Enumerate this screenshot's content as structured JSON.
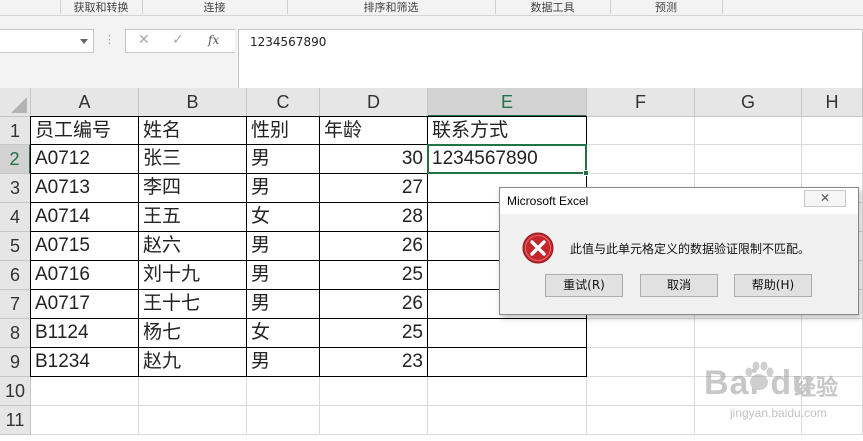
{
  "ribbon": {
    "groups": [
      "获取和转换",
      "连接",
      "排序和筛选",
      "数据工具",
      "预测"
    ]
  },
  "formula_bar": {
    "name_box": "",
    "cancel_symbol": "✕",
    "enter_symbol": "✓",
    "fx_label": "fx",
    "content": "1234567890"
  },
  "sheet": {
    "columns": [
      "A",
      "B",
      "C",
      "D",
      "E",
      "F",
      "G",
      "H"
    ],
    "row_numbers": [
      "1",
      "2",
      "3",
      "4",
      "5",
      "6",
      "7",
      "8",
      "9",
      "10",
      "11"
    ],
    "selected_column": "E",
    "selected_row": "2",
    "header_row": [
      "员工编号",
      "姓名",
      "性别",
      "年龄",
      "联系方式"
    ],
    "rows": [
      [
        "A0712",
        "张三",
        "男",
        "30",
        "1234567890"
      ],
      [
        "A0713",
        "李四",
        "男",
        "27",
        ""
      ],
      [
        "A0714",
        "王五",
        "女",
        "28",
        ""
      ],
      [
        "A0715",
        "赵六",
        "男",
        "26",
        ""
      ],
      [
        "A0716",
        "刘十九",
        "男",
        "25",
        ""
      ],
      [
        "A0717",
        "王十七",
        "男",
        "26",
        ""
      ],
      [
        "B1124",
        "杨七",
        "女",
        "25",
        ""
      ],
      [
        "B1234",
        "赵九",
        "男",
        "23",
        ""
      ]
    ]
  },
  "dialog": {
    "title": "Microsoft Excel",
    "close_label": "✕",
    "message": "此值与此单元格定义的数据验证限制不匹配。",
    "buttons": {
      "retry": "重试(R)",
      "cancel": "取消",
      "help": "帮助(H)"
    },
    "icon": "error-icon"
  },
  "watermark": {
    "brand": "Bai du",
    "brand_cn": "经验",
    "url": "jingyan.baidu.com"
  },
  "colors": {
    "excel_green": "#217346",
    "error_red": "#c4262e"
  }
}
